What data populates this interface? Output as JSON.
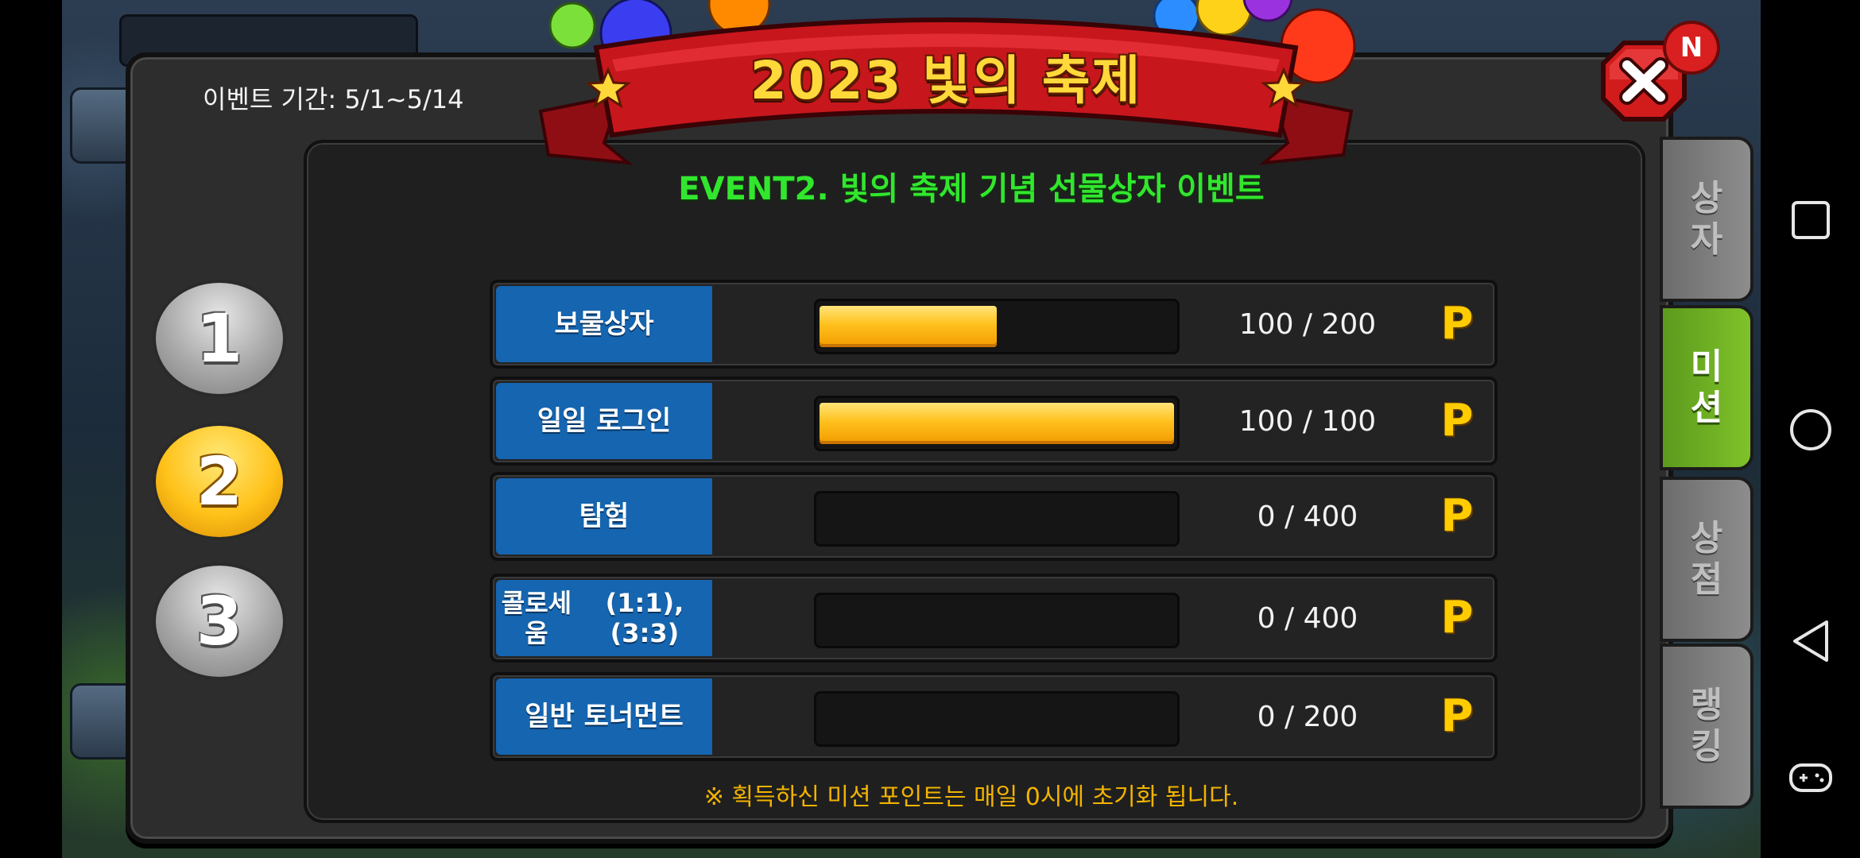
{
  "event_period": "이벤트 기간: 5/1~5/14",
  "banner_title": "2023 빛의 축제",
  "event_title": "EVENT2. 빛의 축제 기념 선물상자 이벤트",
  "steps": [
    "1",
    "2",
    "3"
  ],
  "selected_step": "2",
  "missions": [
    {
      "label": "보물상자",
      "current": 100,
      "max": 200,
      "count_text": "100 / 200",
      "progress": 0.5,
      "point_icon": "P"
    },
    {
      "label": "일일 로그인",
      "current": 100,
      "max": 100,
      "count_text": "100 / 100",
      "progress": 1.0,
      "point_icon": "P"
    },
    {
      "label": "탐험",
      "current": 0,
      "max": 400,
      "count_text": "0 / 400",
      "progress": 0.0,
      "point_icon": "P"
    },
    {
      "label": "콜로세움\n(1:1), (3:3)",
      "label_line1": "콜로세움",
      "label_line2": "(1:1), (3:3)",
      "current": 0,
      "max": 400,
      "count_text": "0 / 400",
      "progress": 0.0,
      "point_icon": "P"
    },
    {
      "label": "일반 토너먼트",
      "current": 0,
      "max": 200,
      "count_text": "0 / 200",
      "progress": 0.0,
      "point_icon": "P"
    }
  ],
  "footnote": "※ 획득하신 미션 포인트는 매일 0시에 초기화 됩니다.",
  "side_tabs": [
    {
      "line1": "상",
      "line2": "자",
      "active": false
    },
    {
      "line1": "미",
      "line2": "션",
      "active": true
    },
    {
      "line1": "상",
      "line2": "점",
      "active": false
    },
    {
      "line1": "랭",
      "line2": "킹",
      "active": false
    }
  ],
  "notification_badge": "N",
  "colors": {
    "accent_green": "#32e62e",
    "label_blue": "#1565b0",
    "bar_gold": "#ffc11d",
    "footnote_gold": "#f2b300",
    "ribbon_red": "#c8161d"
  },
  "icons": {
    "close": "close-icon",
    "point": "point-p-icon",
    "nav_recent": "recent-apps-icon",
    "nav_home": "home-icon",
    "nav_back": "back-icon",
    "nav_game": "gamepad-icon"
  }
}
